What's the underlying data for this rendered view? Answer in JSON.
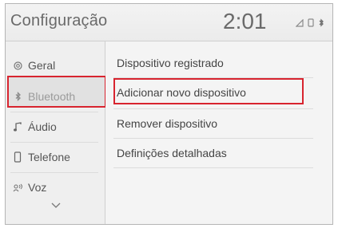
{
  "header": {
    "title": "Configuração",
    "clock": "2:01",
    "status_icons": [
      "signal-icon",
      "phone-icon",
      "bluetooth-icon"
    ]
  },
  "sidebar": {
    "items": [
      {
        "label": "Geral",
        "icon": "gear-icon"
      },
      {
        "label": "Bluetooth",
        "icon": "bluetooth-icon",
        "selected": true
      },
      {
        "label": "Áudio",
        "icon": "music-note-icon"
      },
      {
        "label": "Telefone",
        "icon": "phone-icon"
      },
      {
        "label": "Voz",
        "icon": "voice-icon"
      }
    ],
    "more_icon": "chevron-down-icon"
  },
  "main": {
    "items": [
      {
        "label": "Dispositivo registrado"
      },
      {
        "label": "Adicionar novo dispositivo",
        "highlighted": true
      },
      {
        "label": "Remover dispositivo"
      },
      {
        "label": "Definições detalhadas"
      }
    ]
  },
  "colors": {
    "highlight_border": "#d8242f",
    "text": "#444444",
    "background": "#f1f1f1"
  }
}
